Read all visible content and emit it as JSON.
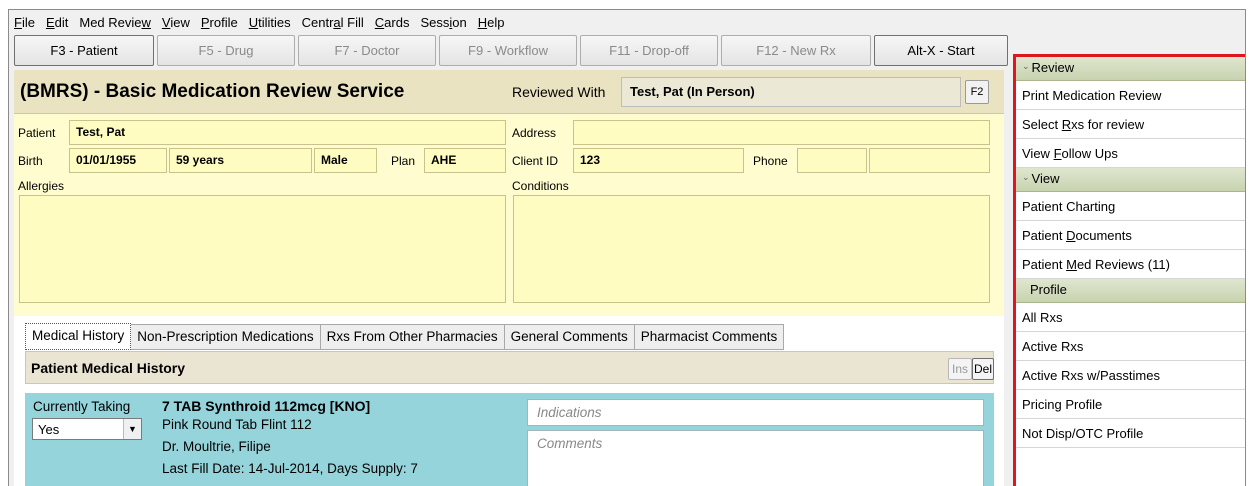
{
  "menu": [
    {
      "pre": "",
      "ul": "F",
      "post": "ile"
    },
    {
      "pre": "",
      "ul": "E",
      "post": "dit"
    },
    {
      "pre": "Med Revie",
      "ul": "w",
      "post": ""
    },
    {
      "pre": "",
      "ul": "V",
      "post": "iew"
    },
    {
      "pre": "",
      "ul": "P",
      "post": "rofile"
    },
    {
      "pre": "",
      "ul": "U",
      "post": "tilities"
    },
    {
      "pre": "Centr",
      "ul": "a",
      "post": "l Fill"
    },
    {
      "pre": "",
      "ul": "C",
      "post": "ards"
    },
    {
      "pre": "Sess",
      "ul": "i",
      "post": "on"
    },
    {
      "pre": "",
      "ul": "H",
      "post": "elp"
    }
  ],
  "toolbar": {
    "patient": "F3 - Patient",
    "drug": "F5 - Drug",
    "doctor": "F7 - Doctor",
    "workflow": "F9 - Workflow",
    "dropoff": "F11 - Drop-off",
    "newrx": "F12 - New Rx",
    "start": "Alt-X - Start"
  },
  "service": {
    "title": "(BMRS) - Basic Medication Review Service",
    "reviewed_label": "Reviewed With",
    "reviewed_value": "Test, Pat (In Person)",
    "f2": "F2"
  },
  "patient": {
    "patient_label": "Patient",
    "patient_value": "Test, Pat",
    "address_label": "Address",
    "address_value": "",
    "birth_label": "Birth",
    "birth_value": "01/01/1955",
    "age_value": "59 years",
    "gender_value": "Male",
    "plan_label": "Plan",
    "plan_value": "AHE",
    "clientid_label": "Client ID",
    "clientid_value": "123",
    "phone_label": "Phone",
    "allergies_label": "Allergies",
    "conditions_label": "Conditions"
  },
  "tabs": [
    "Medical History",
    "Non-Prescription Medications",
    "Rxs From Other Pharmacies",
    "General Comments",
    "Pharmacist Comments"
  ],
  "history": {
    "title": "Patient Medical History",
    "ins": "Ins",
    "del": "Del"
  },
  "med": {
    "currently_taking_label": "Currently Taking",
    "currently_taking_value": "Yes",
    "drug_name": "7 TAB Synthroid 112mcg [KNO]",
    "description": "Pink Round Tab Flint 112",
    "doctor": "Dr. Moultrie, Filipe",
    "last_fill": "Last Fill Date: 14-Jul-2014, Days Supply: 7",
    "indications_placeholder": "Indications",
    "comments_placeholder": "Comments"
  },
  "right_panel": {
    "review_header": "Review",
    "print_review": "Print Medication Review",
    "select_rxs": {
      "pre": "Select ",
      "ul": "R",
      "post": "xs for review"
    },
    "view_follow": {
      "pre": "View ",
      "ul": "F",
      "post": "ollow Ups"
    },
    "view_header": "View",
    "patient_charting": "Patient Charting",
    "patient_documents": {
      "pre": "Patient ",
      "ul": "D",
      "post": "ocuments"
    },
    "patient_med_reviews": {
      "pre": "Patient ",
      "ul": "M",
      "post": "ed Reviews (11)"
    },
    "profile_header": "Profile",
    "all_rxs": "All Rxs",
    "active_rxs": "Active Rxs",
    "active_passtimes": "Active Rxs w/Passtimes",
    "pricing_profile": "Pricing Profile",
    "not_disp": "Not Disp/OTC Profile"
  },
  "colors": {
    "highlight_border": "#e0151d",
    "patient_panel_bg": "#fffdd0",
    "med_row_bg": "#96d4dc",
    "section_header_bg": "#c7d3b0"
  }
}
